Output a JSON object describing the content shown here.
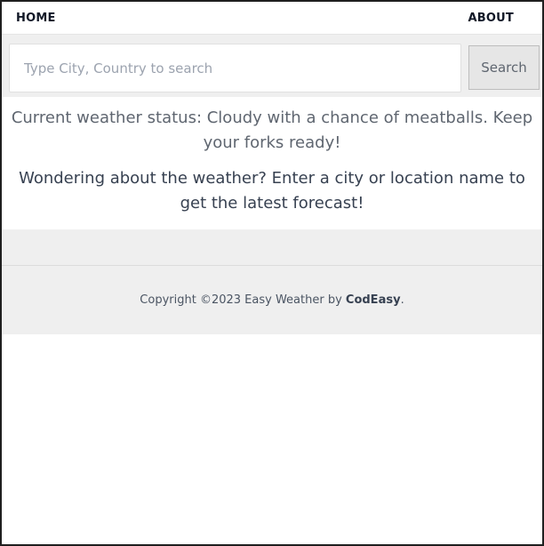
{
  "nav": {
    "home_label": "HOME",
    "about_label": "ABOUT"
  },
  "search": {
    "placeholder": "Type City, Country to search",
    "value": "",
    "button_label": "Search"
  },
  "main": {
    "status_text": "Current weather status: Cloudy with a chance of meatballs. Keep your forks ready!",
    "prompt_text": "Wondering about the weather? Enter a city or location name to get the latest forecast!"
  },
  "footer": {
    "copyright_prefix": "Copyright ©2023 Easy Weather by ",
    "brand": "CodEasy",
    "suffix": "."
  }
}
